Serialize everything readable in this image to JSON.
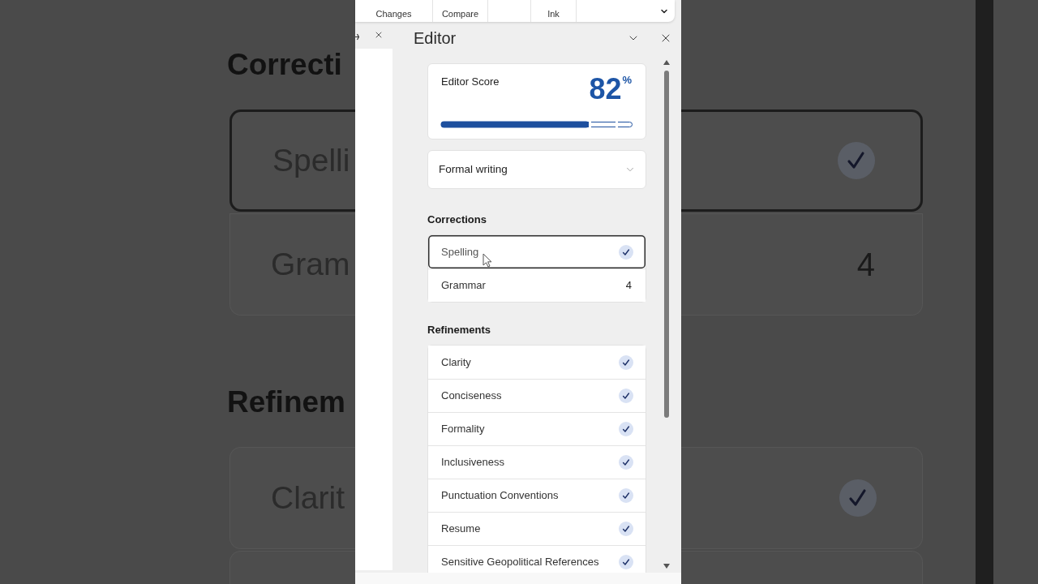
{
  "backdrop_left": {
    "sections": [
      {
        "heading": "Correcti",
        "rows": [
          {
            "label": "Spelli",
            "selected": true
          },
          {
            "label": "Gram",
            "selected": false
          }
        ]
      },
      {
        "heading": "Refinem",
        "rows": [
          {
            "label": "Clarit",
            "selected": false
          }
        ]
      }
    ]
  },
  "backdrop_right": {
    "sections": [
      {
        "rows": [
          {
            "kind": "check",
            "selected": true
          },
          {
            "kind": "count",
            "count": "4",
            "selected": false
          }
        ]
      },
      {
        "rows": [
          {
            "kind": "check",
            "selected": false
          }
        ]
      }
    ]
  },
  "ribbon": {
    "groups": [
      {
        "kind": "labeled",
        "label": "Changes"
      },
      {
        "kind": "labeled",
        "label": "Compare"
      },
      {
        "kind": "blank"
      },
      {
        "kind": "labeled",
        "label": "Ink"
      }
    ]
  },
  "pane": {
    "title": "Editor"
  },
  "score": {
    "label": "Editor Score",
    "value": "82",
    "unit": "%",
    "level": 0.77
  },
  "writing_style": {
    "value": "Formal writing"
  },
  "corrections": {
    "heading": "Corrections",
    "items": [
      {
        "label": "Spelling",
        "kind": "check",
        "selected": true
      },
      {
        "label": "Grammar",
        "kind": "count",
        "count": "4",
        "selected": false
      }
    ]
  },
  "refinements": {
    "heading": "Refinements",
    "items": [
      {
        "label": "Clarity",
        "kind": "check",
        "selected": false
      },
      {
        "label": "Conciseness",
        "kind": "check",
        "selected": false
      },
      {
        "label": "Formality",
        "kind": "check",
        "selected": false
      },
      {
        "label": "Inclusiveness",
        "kind": "check",
        "selected": false
      },
      {
        "label": "Punctuation Conventions",
        "kind": "check",
        "selected": false
      },
      {
        "label": "Resume",
        "kind": "check",
        "selected": false
      },
      {
        "label": "Sensitive Geopolitical References",
        "kind": "check",
        "selected": false
      }
    ]
  }
}
